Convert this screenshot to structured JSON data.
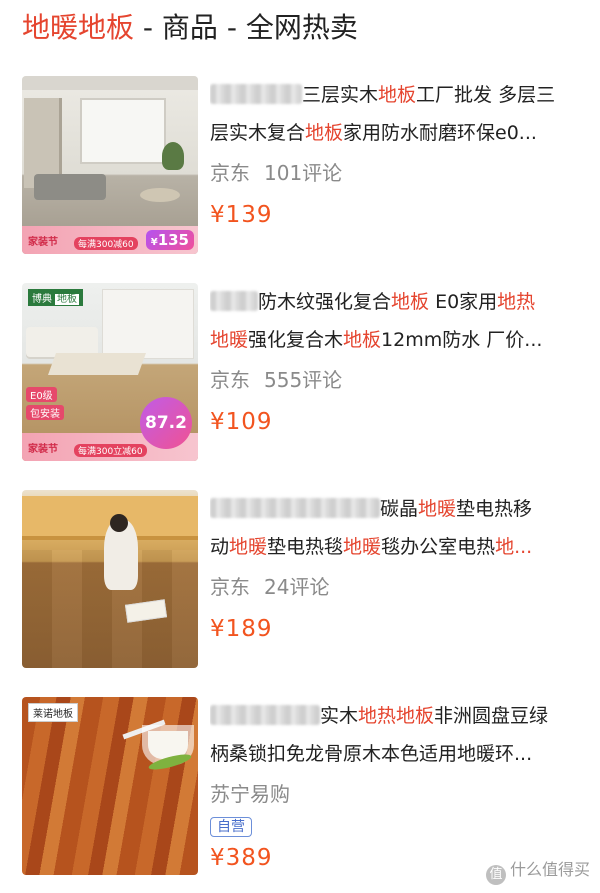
{
  "header": {
    "keyword": "地暖地板",
    "rest": " - 商品 - 全网热卖"
  },
  "products": [
    {
      "thumb": {
        "badge": "家装节",
        "sub": "每满300减60",
        "promo": "135"
      },
      "title_line1": {
        "pre": "三层实木",
        "hl1": "地板",
        "post": "工厂批发 多层三"
      },
      "title_line2": {
        "pre": "层实木复合",
        "hl1": "地板",
        "post": "家用防水耐磨环保e0..."
      },
      "shop": "京东",
      "reviews": "101评论",
      "price": "¥139"
    },
    {
      "thumb": {
        "tag": "博典",
        "tag2": "地板",
        "label1": "E0级",
        "label2": "包安装",
        "badge": "家装节",
        "sub": "每满300立减60",
        "promo": "87.2"
      },
      "title_line1": {
        "pre": "防木纹强化复合",
        "hl1": "地板",
        "mid": " E0家用",
        "hl2": "地热"
      },
      "title_line2": {
        "hl1": "地暖",
        "mid": "强化复合木",
        "hl2": "地板",
        "post": "12mm防水 厂价..."
      },
      "shop": "京东",
      "reviews": "555评论",
      "price": "¥109"
    },
    {
      "title_line1": {
        "pre": "碳晶",
        "hl1": "地暖",
        "post": "垫电热移"
      },
      "title_line2": {
        "pre": "动",
        "hl1": "地暖",
        "mid": "垫电热毯",
        "hl2": "地暖",
        "post": "毯办公室电热",
        "hl3": "地..."
      },
      "shop": "京东",
      "reviews": "24评论",
      "price": "¥189"
    },
    {
      "thumb": {
        "brand": "莱诺地板"
      },
      "title_line1": {
        "pre": "实木",
        "hl1": "地热",
        "hl2": "地板",
        "post": "非洲圆盘豆绿"
      },
      "title_line2": {
        "pre": "柄桑锁扣免龙骨原木本色适用地暖环..."
      },
      "shop": "苏宁易购",
      "badge": "自营",
      "price": "¥389"
    }
  ],
  "watermark": {
    "icon": "值",
    "text": "什么值得买"
  }
}
